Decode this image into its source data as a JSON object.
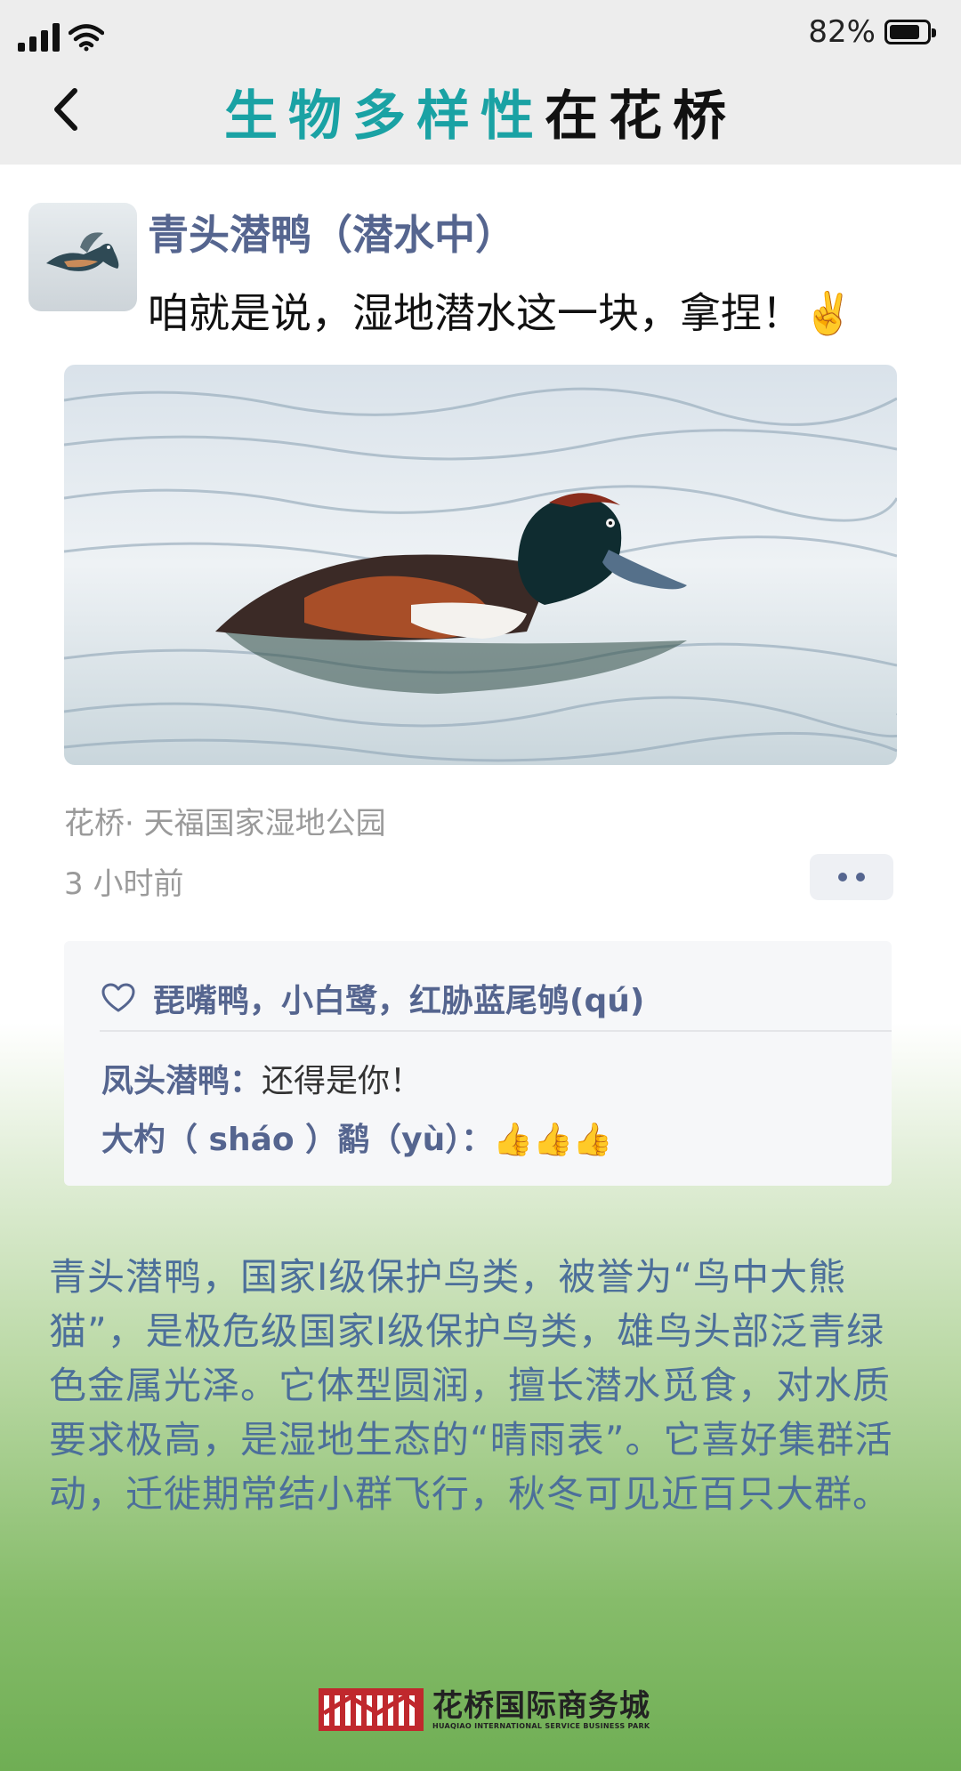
{
  "status_bar": {
    "battery_percent": "82%",
    "battery_level": 0.82
  },
  "header": {
    "title_teal": "生物多样性",
    "title_dark": "在花桥"
  },
  "post": {
    "author": "青头潜鸭（潜水中）",
    "message": "咱就是说，湿地潜水这一块，拿捏！✌️",
    "location": "花桥· 天福国家湿地公园",
    "time": "3 小时前"
  },
  "interactions": {
    "likes": "琵嘴鸭，小白鹭，红胁蓝尾鸲(qú)",
    "comments": [
      {
        "name": "凤头潜鸭：",
        "text": "还得是你！"
      },
      {
        "name": "大杓（ sháo ）鹬（yù）：",
        "text": "👍👍👍"
      }
    ]
  },
  "description": "青头潜鸭，国家I级保护鸟类，被誉为“鸟中大熊猫”，是极危级国家I级保护鸟类，雄鸟头部泛青绿色金属光泽。它体型圆润，擅长潜水觅食，对水质要求极高，是湿地生态的“晴雨表”。它喜好集群活动，迁徙期常结小群飞行，秋冬可见近百只大群。",
  "footer": {
    "logo_cn": "花桥国际商务城",
    "logo_en": "HUAQIAO INTERNATIONAL SERVICE BUSINESS PARK"
  },
  "colors": {
    "teal": "#1aa2a4",
    "name_blue": "#55658f",
    "desc_blue": "#4c6f9a",
    "logo_red": "#c0282d"
  }
}
